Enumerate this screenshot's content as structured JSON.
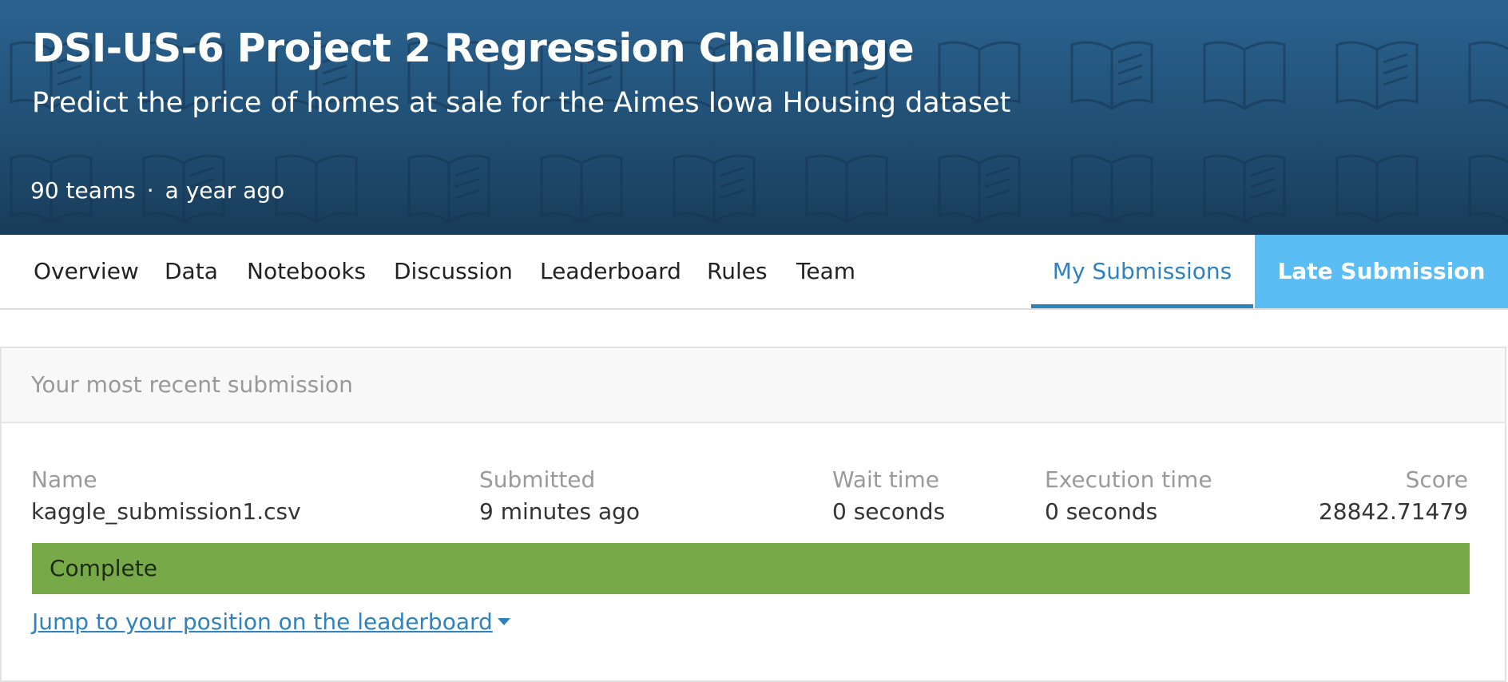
{
  "header": {
    "title": "DSI-US-6 Project 2 Regression Challenge",
    "subtitle": "Predict the price of homes at sale for the Aimes Iowa Housing dataset",
    "teams": "90 teams",
    "separator": "·",
    "age": "a year ago",
    "background_colors": [
      "#2a6390",
      "#183c59"
    ],
    "pattern_icon": "open-book-icon"
  },
  "tabs": {
    "overview": "Overview",
    "data": "Data",
    "notebooks": "Notebooks",
    "discussion": "Discussion",
    "leaderboard": "Leaderboard",
    "rules": "Rules",
    "team": "Team",
    "my_submissions": "My Submissions",
    "late_submission": "Late Submission",
    "active": "My Submissions",
    "accent_color": "#2f82be",
    "late_button_color": "#5abef4"
  },
  "submission": {
    "heading": "Your most recent submission",
    "name_label": "Name",
    "name_value": "kaggle_submission1.csv",
    "submitted_label": "Submitted",
    "submitted_value": "9 minutes ago",
    "wait_label": "Wait time",
    "wait_value": "0 seconds",
    "exec_label": "Execution time",
    "exec_value": "0 seconds",
    "score_label": "Score",
    "score_value": "28842.71479",
    "status": "Complete",
    "status_color": "#78a949",
    "jump_link": "Jump to your position on the leaderboard"
  }
}
